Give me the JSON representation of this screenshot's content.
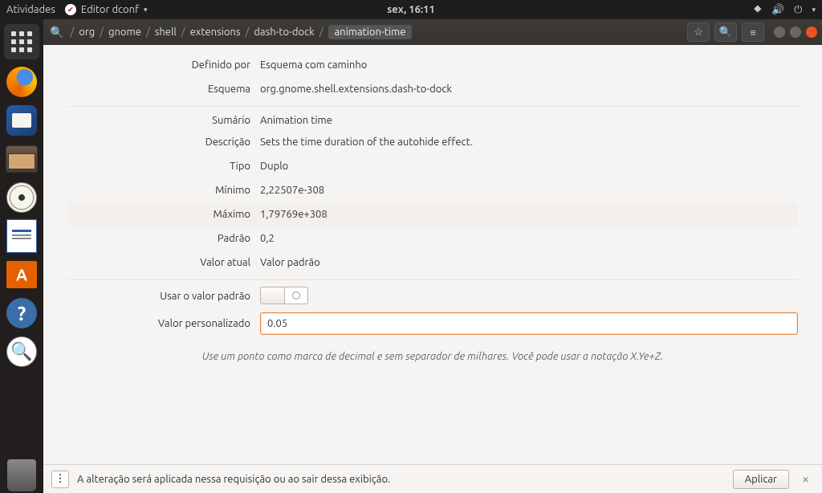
{
  "topbar": {
    "activities": "Atividades",
    "app": "Editor dconf",
    "clock": "sex, 16:11"
  },
  "breadcrumb": [
    "/",
    "org",
    "/",
    "gnome",
    "/",
    "shell",
    "/",
    "extensions",
    "/",
    "dash-to-dock",
    "/",
    "animation-time"
  ],
  "rows": {
    "definido_por_label": "Definido por",
    "definido_por_value": "Esquema com caminho",
    "esquema_label": "Esquema",
    "esquema_value": "org.gnome.shell.extensions.dash-to-dock",
    "sumario_label": "Sumário",
    "sumario_value": "Animation time",
    "descricao_label": "Descrição",
    "descricao_value": "Sets the time duration of the autohide effect.",
    "tipo_label": "Tipo",
    "tipo_value": "Duplo",
    "minimo_label": "Mínimo",
    "minimo_value": "2,22507e-308",
    "maximo_label": "Máximo",
    "maximo_value": "1,79769e+308",
    "padrao_label": "Padrão",
    "padrao_value": "0,2",
    "valor_atual_label": "Valor atual",
    "valor_atual_value": "Valor padrão",
    "usar_padrao_label": "Usar o valor padrão",
    "valor_personalizado_label": "Valor personalizado",
    "valor_personalizado_value": "0.05"
  },
  "hint": "Use um ponto como marca de decimal e sem separador de milhares. Você pode usar a notação X.Ye+Z.",
  "statusbar": {
    "message": "A alteração será aplicada nessa requisição ou ao sair dessa exibição.",
    "apply": "Aplicar"
  }
}
